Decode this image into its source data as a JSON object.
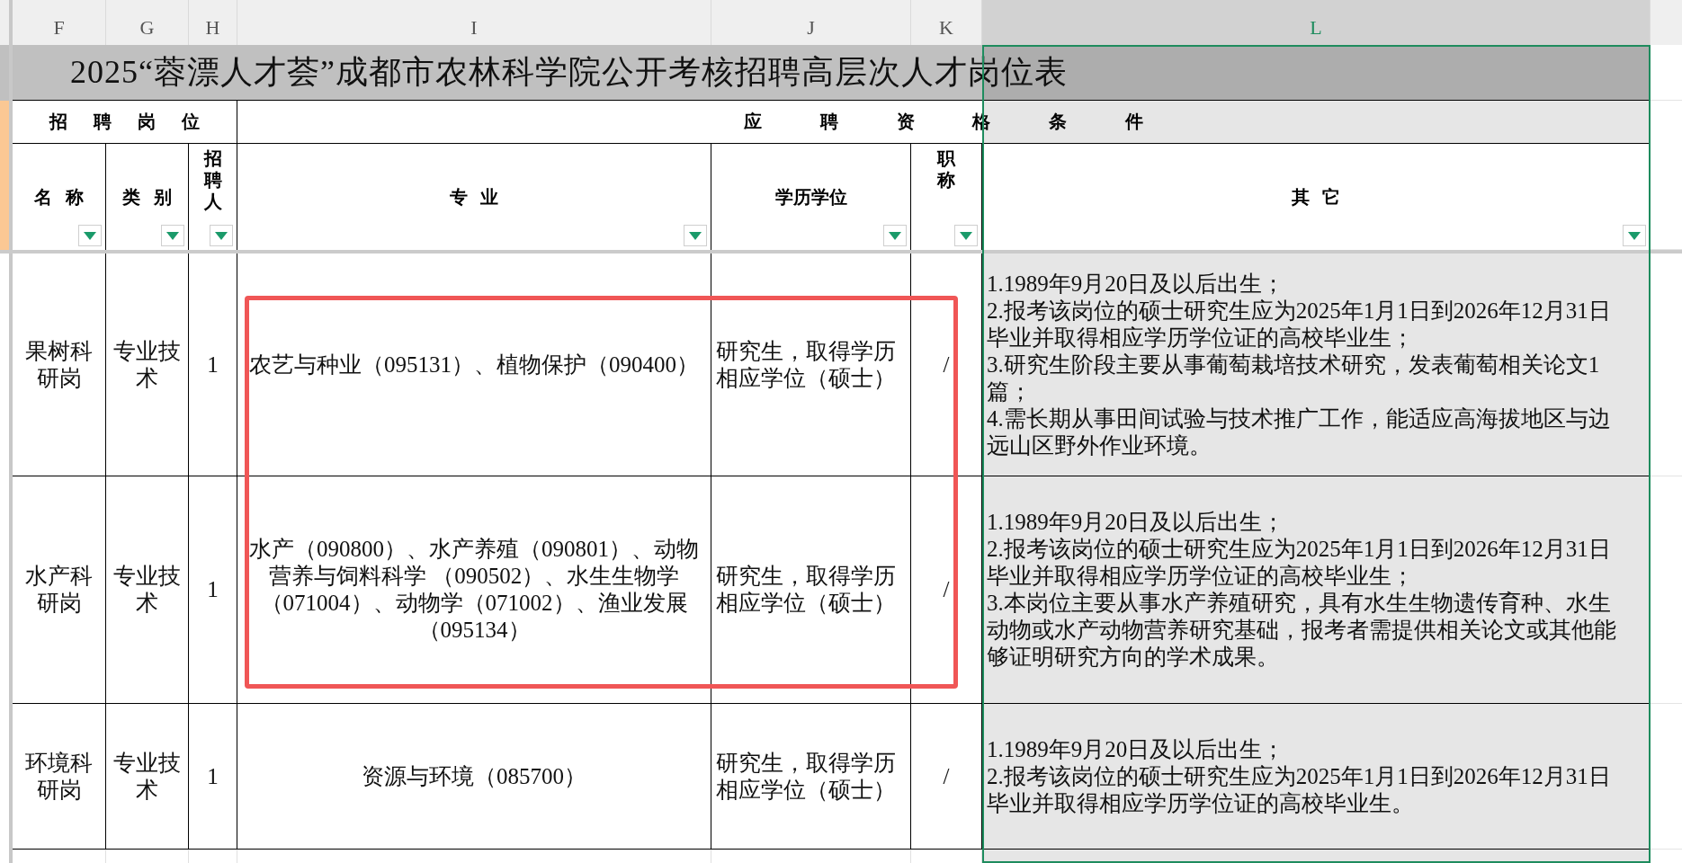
{
  "columns": [
    {
      "letter": "F",
      "selected": false
    },
    {
      "letter": "G",
      "selected": false
    },
    {
      "letter": "H",
      "selected": false
    },
    {
      "letter": "I",
      "selected": false
    },
    {
      "letter": "J",
      "selected": false
    },
    {
      "letter": "K",
      "selected": false
    },
    {
      "letter": "L",
      "selected": true
    }
  ],
  "title": "2025“蓉漂人才荟”成都市农林科学院公开考核招聘高层次人才岗位表",
  "groups": [
    "招 聘 岗 位",
    "应 聘 资 格 条 件"
  ],
  "headers": [
    {
      "label": "名 称",
      "filter": true
    },
    {
      "label": "类 别",
      "filter": true
    },
    {
      "label": "招聘人",
      "filter": true
    },
    {
      "label": "专 业",
      "filter": true
    },
    {
      "label": "学历学位",
      "filter": true
    },
    {
      "label": "职称",
      "filter": true
    },
    {
      "label": "其 它",
      "filter": true
    }
  ],
  "rows": [
    {
      "name": "果树科研岗",
      "category": "专业技术",
      "count": "1",
      "majors": "农艺与种业（095131）、植物保护（090400）",
      "education": "研究生，取得学历相应学位（硕士）",
      "title": "/",
      "requirements": [
        "1.1989年9月20日及以后出生；",
        "2.报考该岗位的硕士研究生应为2025年1月1日到2026年12月31日毕业并取得相应学历学位证的高校毕业生；",
        "3.研究生阶段主要从事葡萄栽培技术研究，发表葡萄相关论文1篇；",
        "4.需长期从事田间试验与技术推广工作，能适应高海拔地区与边远山区野外作业环境。"
      ],
      "highlighted": true
    },
    {
      "name": "水产科研岗",
      "category": "专业技术",
      "count": "1",
      "majors": "水产（090800）、水产养殖（090801）、动物营养与饲料科学 （090502）、水生生物学（071004）、动物学（071002）、渔业发展（095134）",
      "education": "研究生，取得学历相应学位（硕士）",
      "title": "/",
      "requirements": [
        "1.1989年9月20日及以后出生；",
        "2.报考该岗位的硕士研究生应为2025年1月1日到2026年12月31日毕业并取得相应学历学位证的高校毕业生；",
        "3.本岗位主要从事水产养殖研究，具有水生生物遗传育种、水生动物或水产动物营养研究基础，报考者需提供相关论文或其他能够证明研究方向的学术成果。"
      ],
      "highlighted": true
    },
    {
      "name": "环境科研岗",
      "category": "专业技术",
      "count": "1",
      "majors": "资源与环境（085700）",
      "education": "研究生，取得学历相应学位（硕士）",
      "title": "/",
      "requirements": [
        "1.1989年9月20日及以后出生；",
        "2.报考该岗位的硕士研究生应为2025年1月1日到2026年12月31日毕业并取得相应学历学位证的高校毕业生。"
      ],
      "highlighted": false
    }
  ],
  "annotation": {
    "kind": "rectangle"
  }
}
